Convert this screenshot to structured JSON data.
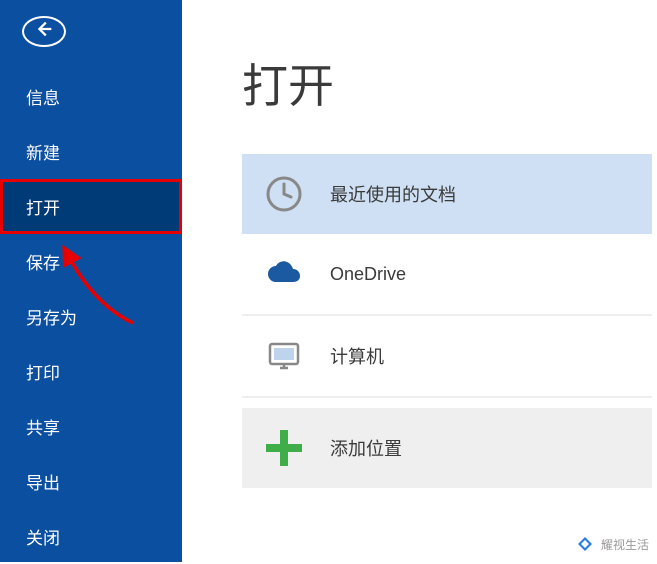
{
  "sidebar": {
    "items": [
      {
        "label": "信息"
      },
      {
        "label": "新建"
      },
      {
        "label": "打开"
      },
      {
        "label": "保存"
      },
      {
        "label": "另存为"
      },
      {
        "label": "打印"
      },
      {
        "label": "共享"
      },
      {
        "label": "导出"
      },
      {
        "label": "关闭"
      }
    ]
  },
  "page": {
    "title": "打开"
  },
  "options": {
    "recent": "最近使用的文档",
    "onedrive": "OneDrive",
    "computer": "计算机",
    "add_place": "添加位置"
  },
  "colors": {
    "sidebar": "#0b4fa0",
    "sidebar_active": "#003a77",
    "highlight": "#e60000",
    "selected_option": "#cfe0f4",
    "onedrive_blue": "#1b5aa1",
    "plus_green": "#3fae49"
  },
  "watermark": {
    "text": "耀视生活"
  }
}
